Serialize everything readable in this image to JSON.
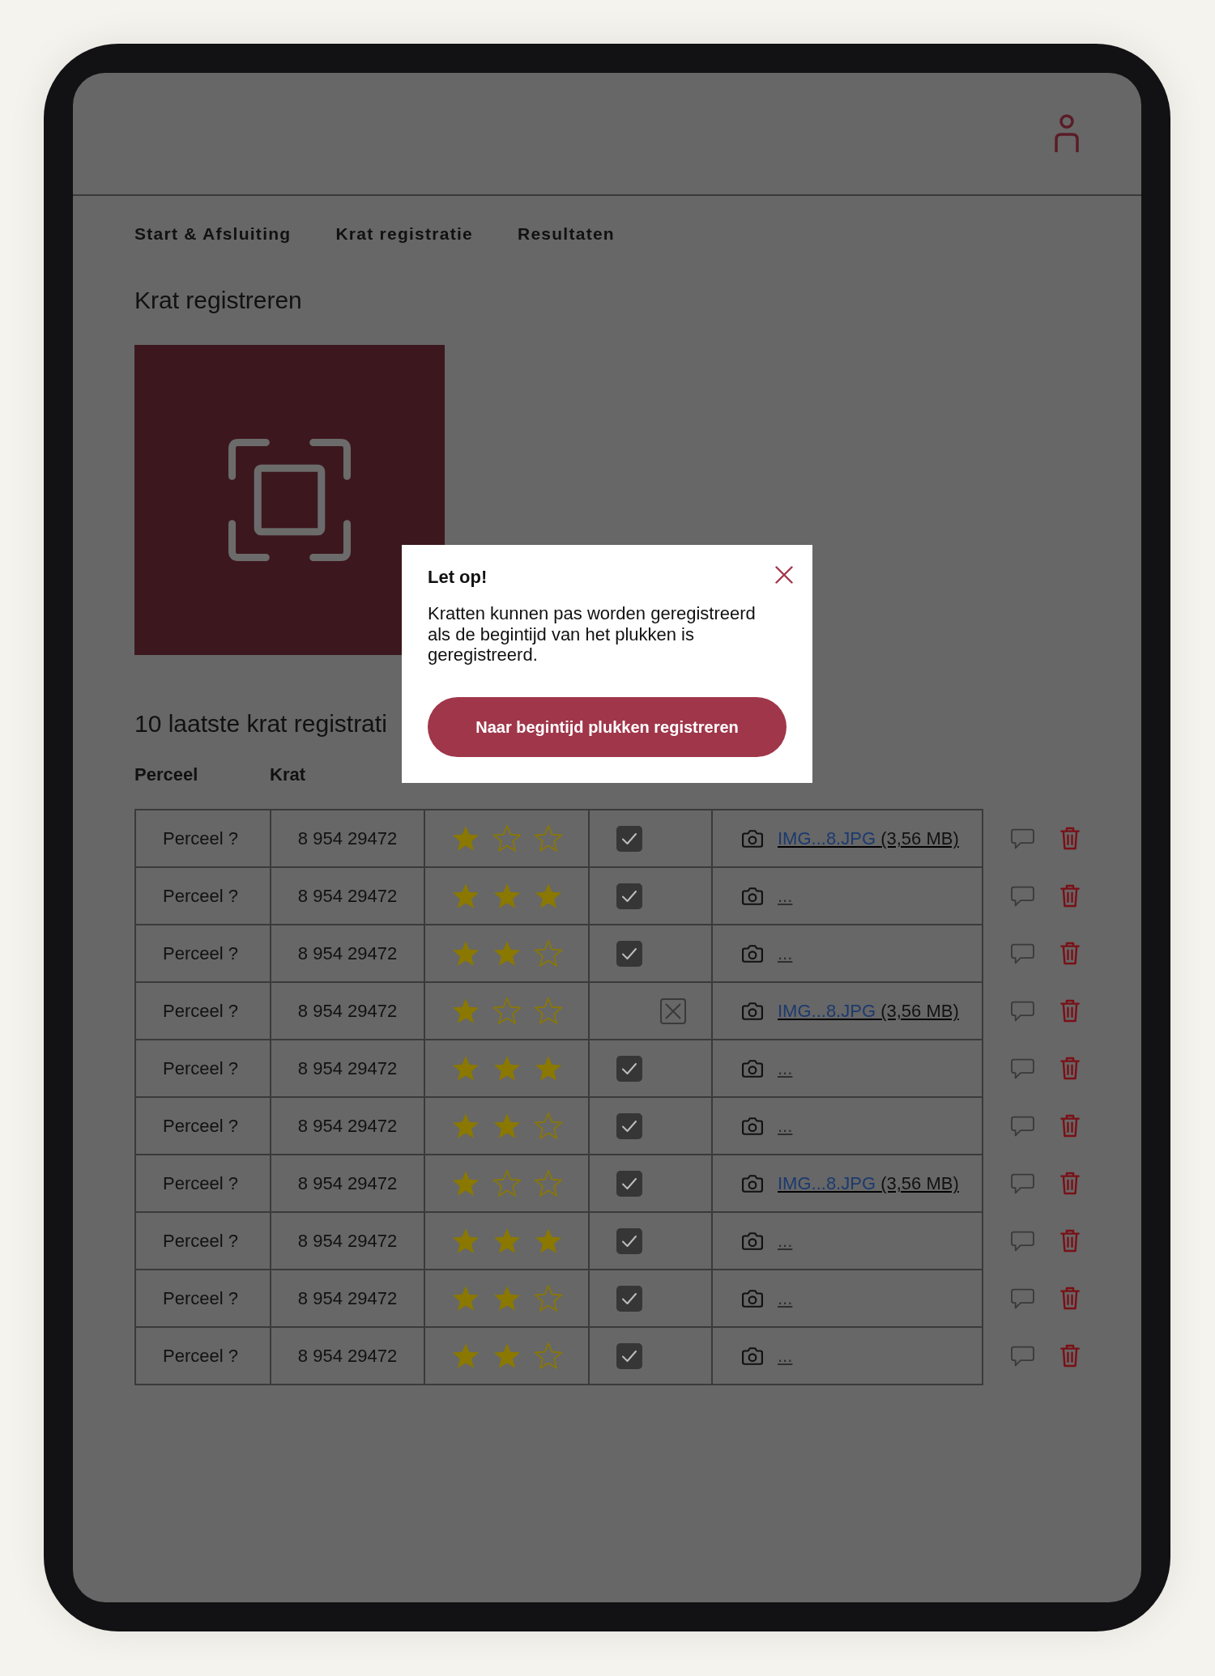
{
  "nav": [
    {
      "label": "Start & Afsluiting"
    },
    {
      "label": "Krat registratie"
    },
    {
      "label": "Resultaten"
    }
  ],
  "page_title": "Krat registreren",
  "recent": {
    "title": "10 laatste krat registrati",
    "columns": [
      "Perceel",
      "Krat"
    ],
    "rows": [
      {
        "perceel": "Perceel ?",
        "krat": "8 954 29472",
        "stars": 1,
        "checked": true,
        "photo": {
          "kind": "file",
          "name": "IMG...8.JPG",
          "size": "(3,56 MB)"
        }
      },
      {
        "perceel": "Perceel ?",
        "krat": "8 954 29472",
        "stars": 3,
        "checked": true,
        "photo": {
          "kind": "empty",
          "name": "..."
        }
      },
      {
        "perceel": "Perceel ?",
        "krat": "8 954 29472",
        "stars": 2,
        "checked": true,
        "photo": {
          "kind": "empty",
          "name": "..."
        }
      },
      {
        "perceel": "Perceel ?",
        "krat": "8 954 29472",
        "stars": 1,
        "checked": false,
        "photo": {
          "kind": "file",
          "name": "IMG...8.JPG",
          "size": "(3,56 MB)"
        }
      },
      {
        "perceel": "Perceel ?",
        "krat": "8 954 29472",
        "stars": 3,
        "checked": true,
        "photo": {
          "kind": "empty",
          "name": "..."
        }
      },
      {
        "perceel": "Perceel ?",
        "krat": "8 954 29472",
        "stars": 2,
        "checked": true,
        "photo": {
          "kind": "empty",
          "name": "..."
        }
      },
      {
        "perceel": "Perceel ?",
        "krat": "8 954 29472",
        "stars": 1,
        "checked": true,
        "photo": {
          "kind": "file",
          "name": "IMG...8.JPG",
          "size": "(3,56 MB)"
        }
      },
      {
        "perceel": "Perceel ?",
        "krat": "8 954 29472",
        "stars": 3,
        "checked": true,
        "photo": {
          "kind": "empty",
          "name": "..."
        }
      },
      {
        "perceel": "Perceel ?",
        "krat": "8 954 29472",
        "stars": 2,
        "checked": true,
        "photo": {
          "kind": "empty",
          "name": "..."
        }
      },
      {
        "perceel": "Perceel ?",
        "krat": "8 954 29472",
        "stars": 2,
        "checked": true,
        "photo": {
          "kind": "empty",
          "name": "..."
        }
      }
    ]
  },
  "dialog": {
    "title": "Let op!",
    "message": "Kratten kunnen pas worden geregistreerd als de begintijd van het plukken is geregistreerd.",
    "button": "Naar begintijd plukken registreren"
  }
}
